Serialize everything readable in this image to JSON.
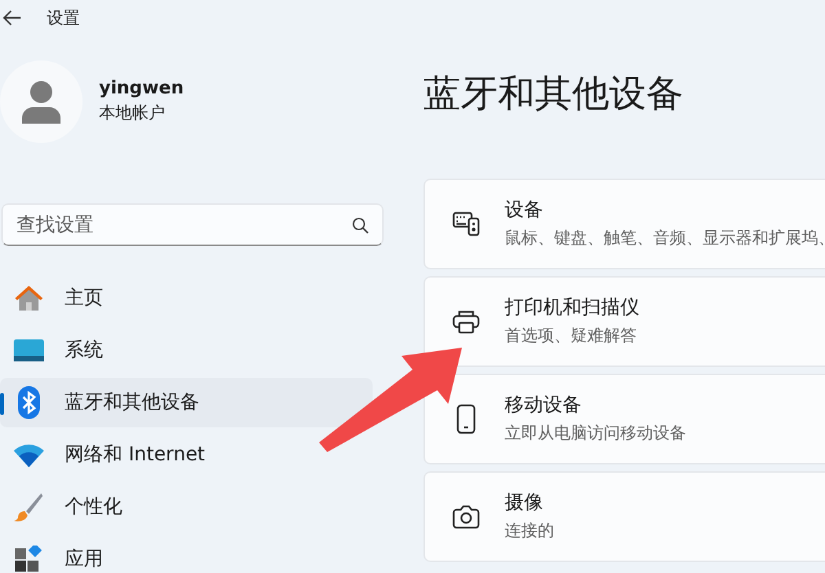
{
  "window": {
    "title": "设置"
  },
  "user": {
    "name": "yingwen",
    "account_type": "本地帐户"
  },
  "search": {
    "placeholder": "查找设置"
  },
  "nav": [
    {
      "label": "主页",
      "kind": "home",
      "selected": false
    },
    {
      "label": "系统",
      "kind": "system",
      "selected": false
    },
    {
      "label": "蓝牙和其他设备",
      "kind": "bluetooth",
      "selected": true
    },
    {
      "label": "网络和 Internet",
      "kind": "network",
      "selected": false
    },
    {
      "label": "个性化",
      "kind": "brush",
      "selected": false
    },
    {
      "label": "应用",
      "kind": "apps",
      "selected": false
    }
  ],
  "page_title": "蓝牙和其他设备",
  "cards": [
    {
      "kind": "devices",
      "title": "设备",
      "subtitle": "鼠标、键盘、触笔、音频、显示器和扩展坞、"
    },
    {
      "kind": "printer",
      "title": "打印机和扫描仪",
      "subtitle": "首选项、疑难解答"
    },
    {
      "kind": "phone",
      "title": "移动设备",
      "subtitle": "立即从电脑访问移动设备"
    },
    {
      "kind": "camera",
      "title": "摄像",
      "subtitle": "连接的"
    }
  ]
}
